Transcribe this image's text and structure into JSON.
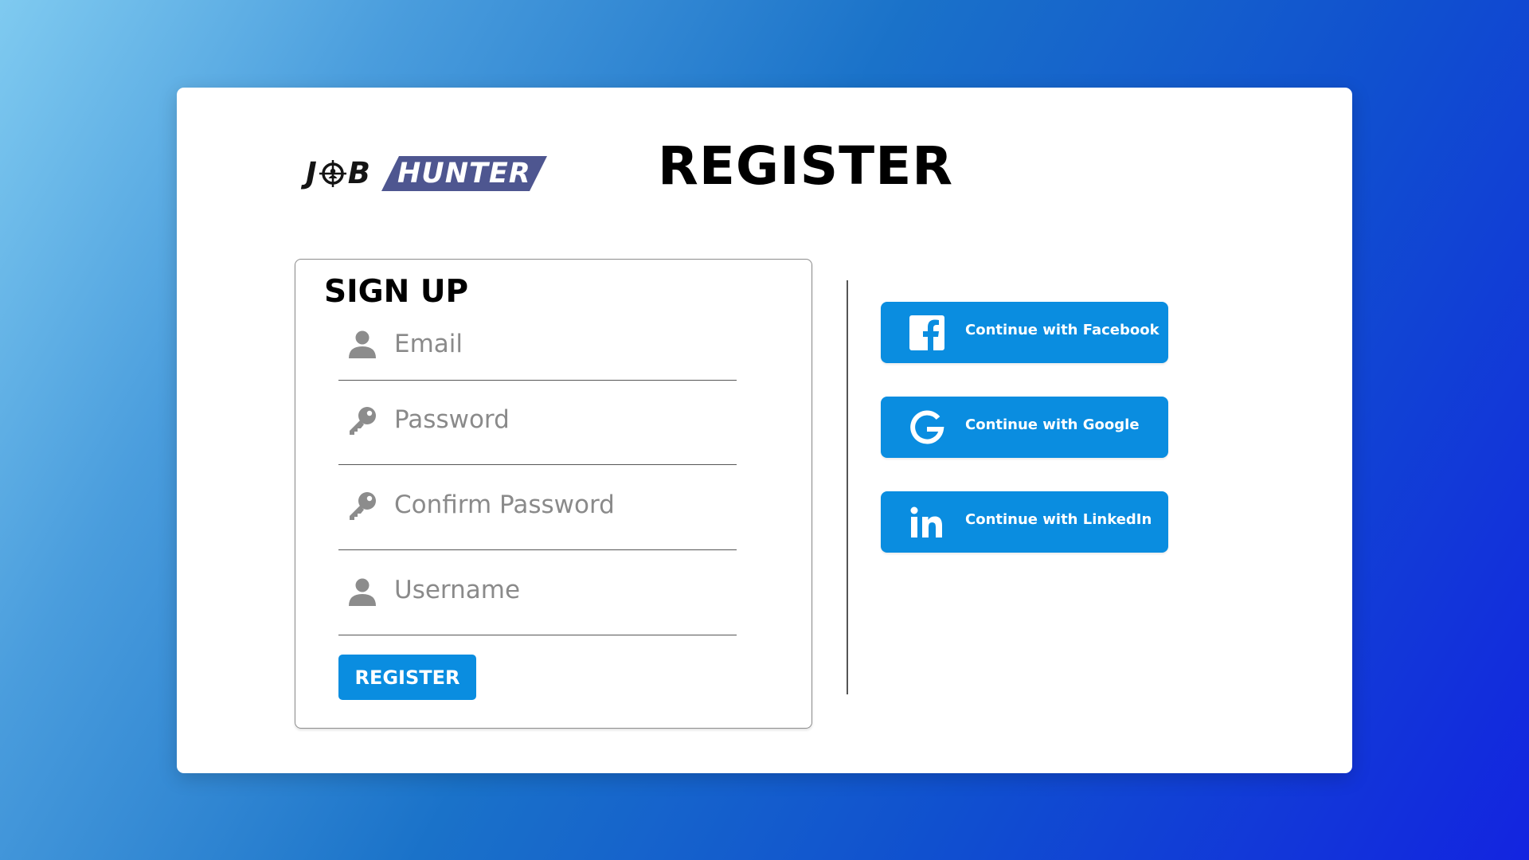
{
  "brand": {
    "logo_part1": "J",
    "logo_part2": "B",
    "logo_part3": "HUNTER"
  },
  "page": {
    "title": "REGISTER"
  },
  "form": {
    "title": "SIGN UP",
    "fields": [
      {
        "placeholder": "Email",
        "icon": "user-icon"
      },
      {
        "placeholder": "Password",
        "icon": "key-icon"
      },
      {
        "placeholder": "Confirm Password",
        "icon": "key-icon"
      },
      {
        "placeholder": "Username",
        "icon": "user-icon"
      }
    ],
    "submit_label": "REGISTER"
  },
  "social": [
    {
      "label": "Continue with Facebook",
      "icon": "facebook-icon"
    },
    {
      "label": "Continue with Google",
      "icon": "google-icon"
    },
    {
      "label": "Continue with LinkedIn",
      "icon": "linkedin-icon"
    }
  ],
  "colors": {
    "accent": "#0a8de0",
    "logo_band": "#4e5690",
    "icon_gray": "#8c8c8c"
  }
}
